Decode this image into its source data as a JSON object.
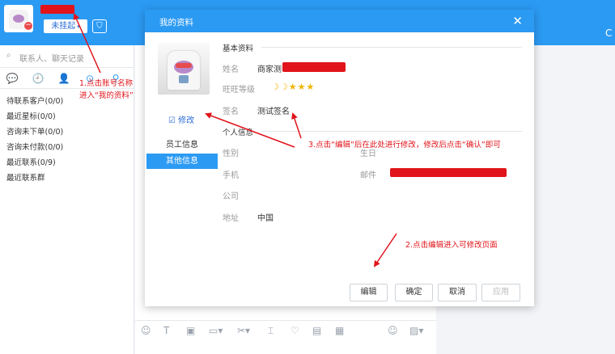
{
  "header": {
    "status_label": "未挂起",
    "status_caret": "▾",
    "avatar_badge": "−",
    "shield_icon": "⛉",
    "refresh_icon": "C"
  },
  "left": {
    "search_placeholder": "联系人、聊天记录",
    "search_icon": "⌕",
    "tab_icons": [
      "💬",
      "🕘",
      "👤",
      "⊙",
      "⚲"
    ],
    "items": [
      {
        "label": "待联系客户(0/0)"
      },
      {
        "label": "最近星标(0/0)"
      },
      {
        "label": "咨询未下单(0/0)"
      },
      {
        "label": "咨询未付款(0/0)"
      },
      {
        "label": "最近联系(0/9)"
      },
      {
        "label": "最近联系群"
      }
    ]
  },
  "toolbar": {
    "icons": [
      "☺",
      "T",
      "▣",
      "▭▾",
      "✂▾",
      "⌶",
      "♡",
      "▤",
      "▦",
      "☺",
      "▨▾"
    ]
  },
  "dialog": {
    "title": "我的资料",
    "close_icon": "✕",
    "edit_link": "☑ 修改",
    "nav": [
      {
        "label": "员工信息",
        "active": false
      },
      {
        "label": "其他信息",
        "active": true
      }
    ],
    "basic_title": "基本资料",
    "personal_title": "个人信息",
    "fields": {
      "name_label": "姓名",
      "name_value": "商家测",
      "level_label": "旺旺等级",
      "level_icons": "☽☽★★★",
      "signature_label": "签名",
      "signature_value": "测试签名",
      "gender_label": "性别",
      "birthday_label": "生日",
      "phone_label": "手机",
      "email_label": "邮件",
      "company_label": "公司",
      "address_label": "地址",
      "address_value": "中国"
    },
    "buttons": {
      "edit": "编辑",
      "confirm": "确定",
      "cancel": "取消",
      "apply": "应用"
    }
  },
  "annotations": {
    "a1_line1": "1.点击账号名称",
    "a1_line2": "进入“我的资料”",
    "a2": "2.点击编辑进入可修改页面",
    "a3": "3.点击“编辑”后在此处进行修改，修改后点击“确认”即可"
  },
  "colors": {
    "brand": "#2b9af3",
    "annotation": "#e1141b"
  }
}
